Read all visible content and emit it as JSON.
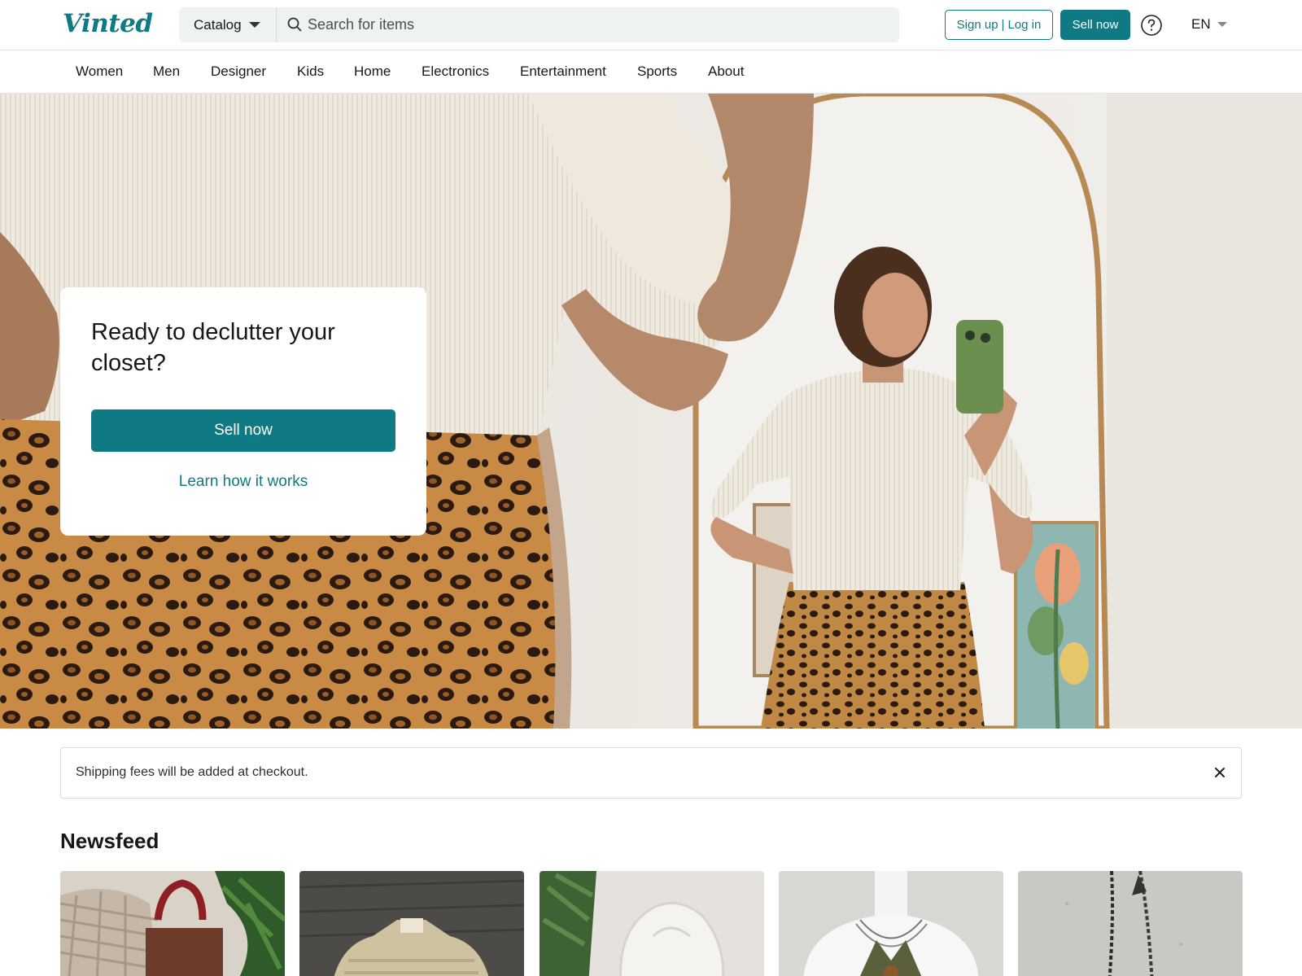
{
  "header": {
    "logo_text": "Vinted",
    "catalog_label": "Catalog",
    "search_placeholder": "Search for items",
    "signup_label": "Sign up",
    "separator": "|",
    "login_label": "Log in",
    "sell_now_label": "Sell now",
    "language": "EN"
  },
  "nav": {
    "items": [
      "Women",
      "Men",
      "Designer",
      "Kids",
      "Home",
      "Electronics",
      "Entertainment",
      "Sports",
      "About"
    ]
  },
  "hero": {
    "title": "Ready to declutter your closet?",
    "sell_button": "Sell now",
    "learn_link": "Learn how it works"
  },
  "notice": {
    "text": "Shipping fees will be added at checkout."
  },
  "newsfeed": {
    "title": "Newsfeed",
    "items": [
      {
        "image": "woven-bag-photo"
      },
      {
        "image": "striped-polo-shirt-photo"
      },
      {
        "image": "white-hoodie-photo"
      },
      {
        "image": "olive-bikini-top-photo"
      },
      {
        "image": "chain-necklace-photo"
      }
    ]
  },
  "colors": {
    "brand": "#0f7a83",
    "text": "#171717",
    "search_bg": "#eff2f2"
  }
}
